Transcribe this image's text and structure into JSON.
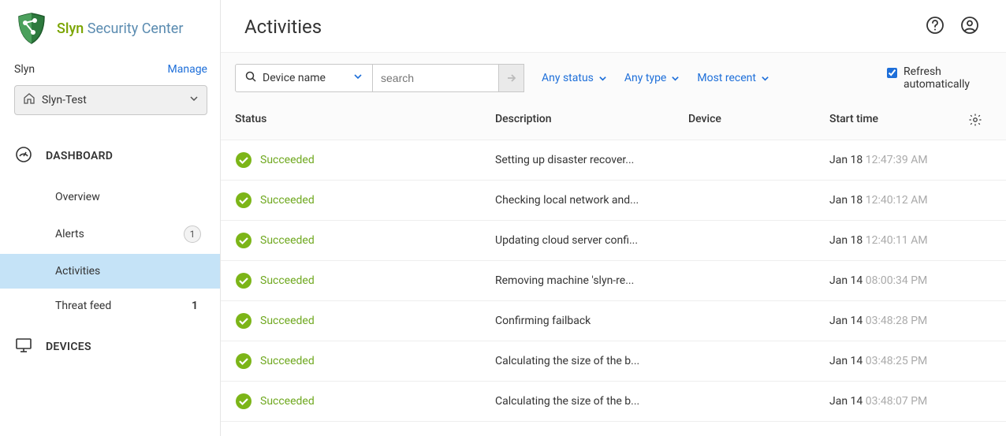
{
  "brand": {
    "first": "Slyn",
    "rest": " Security Center"
  },
  "org": {
    "name": "Slyn",
    "manage": "Manage"
  },
  "group": {
    "name": "Slyn-Test"
  },
  "nav": {
    "dashboard": {
      "label": "DASHBOARD",
      "items": [
        {
          "label": "Overview",
          "badge": null,
          "active": false
        },
        {
          "label": "Alerts",
          "badge": "1",
          "badgeStyle": "circle",
          "active": false
        },
        {
          "label": "Activities",
          "badge": null,
          "active": true
        },
        {
          "label": "Threat feed",
          "badge": "1",
          "badgeStyle": "plain",
          "active": false
        }
      ]
    },
    "devices": {
      "label": "DEVICES"
    }
  },
  "page": {
    "title": "Activities"
  },
  "toolbar": {
    "filterField": "Device name",
    "searchPlaceholder": "search",
    "statusFilter": "Any status",
    "typeFilter": "Any type",
    "sort": "Most recent",
    "refreshLabel": "Refresh automatically",
    "refreshChecked": true
  },
  "columns": {
    "status": "Status",
    "description": "Description",
    "device": "Device",
    "start": "Start time"
  },
  "statusLabel": "Succeeded",
  "activities": [
    {
      "desc": "Setting up disaster recover...",
      "date": "Jan 18",
      "time": "12:47:39 AM"
    },
    {
      "desc": "Checking local network and...",
      "date": "Jan 18",
      "time": "12:40:12 AM"
    },
    {
      "desc": "Updating cloud server confi...",
      "date": "Jan 18",
      "time": "12:40:11 AM"
    },
    {
      "desc": "Removing machine 'slyn-re...",
      "date": "Jan 14",
      "time": "08:00:34 PM"
    },
    {
      "desc": "Confirming failback",
      "date": "Jan 14",
      "time": "03:48:28 PM"
    },
    {
      "desc": "Calculating the size of the b...",
      "date": "Jan 14",
      "time": "03:48:25 PM"
    },
    {
      "desc": "Calculating the size of the b...",
      "date": "Jan 14",
      "time": "03:48:07 PM"
    }
  ]
}
